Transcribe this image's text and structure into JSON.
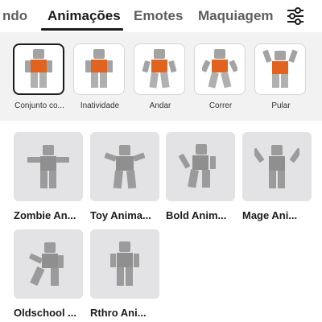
{
  "tabs": {
    "prev_partial": "ndo",
    "active": "Animações",
    "emotes": "Emotes",
    "makeup": "Maquiagem"
  },
  "filter_icon": "sliders-icon",
  "sub_items": [
    {
      "label": "Conjunto co...",
      "selected": true
    },
    {
      "label": "Inatividade",
      "selected": false
    },
    {
      "label": "Andar",
      "selected": false
    },
    {
      "label": "Correr",
      "selected": false
    },
    {
      "label": "Pular",
      "selected": false
    }
  ],
  "packs": [
    {
      "label": "Zombie An..."
    },
    {
      "label": "Toy Anima..."
    },
    {
      "label": "Bold Anim..."
    },
    {
      "label": "Mage Ani..."
    },
    {
      "label": "Oldschool ..."
    },
    {
      "label": "Rthro Ani..."
    }
  ],
  "colors": {
    "avatar_gray": "#a3a3a3",
    "shirt_orange": "#e0631f",
    "tile_bg": "#e3e3e5"
  }
}
